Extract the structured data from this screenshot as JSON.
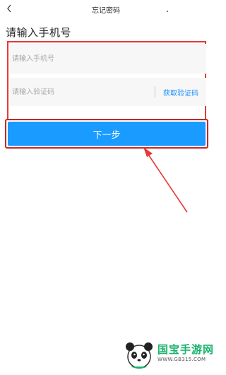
{
  "nav": {
    "title": "忘记密码"
  },
  "page": {
    "title": "请输入手机号"
  },
  "form": {
    "phone_placeholder": "请输入手机号",
    "phone_value": "",
    "code_placeholder": "请输入验证码",
    "code_value": "",
    "get_code_label": "获取验证码"
  },
  "buttons": {
    "next_label": "下一步"
  },
  "watermark": {
    "brand": "国宝手游网",
    "url": "WWW.GB315.COM"
  },
  "colors": {
    "primary": "#1a9bff",
    "annotation": "#e53935",
    "link": "#1e90ff",
    "watermark": "#19b46b"
  }
}
